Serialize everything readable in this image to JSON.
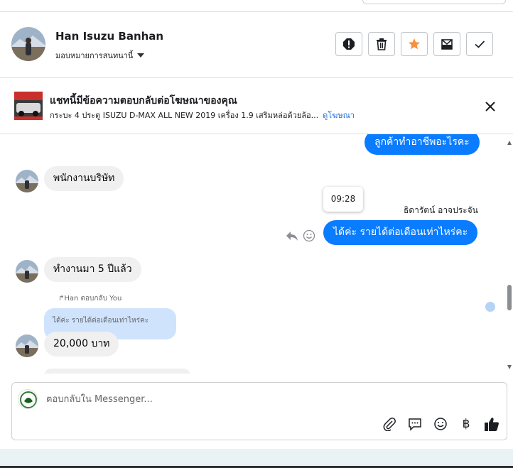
{
  "header": {
    "contact_name": "Han Isuzu Banhan",
    "assign_label": "มอบหมายการสนทนานี้",
    "action_icons": [
      "alert-icon",
      "trash-icon",
      "star-icon",
      "mark-unread-icon",
      "check-icon"
    ],
    "star_color": "#f5903d"
  },
  "ad": {
    "title": "แชทนี้มีข้อความตอบกลับต่อโฆษณาของคุณ",
    "description": "กระบะ 4 ประตู ISUZU D-MAX ALL NEW 2019 เครื่อง 1.9 เสริมหล่อด้วยล้อ...",
    "link": "ดูโฆษณา"
  },
  "messages": {
    "m1": "ลูกค้าทำอาชีพอะไรคะ",
    "m2": "พนักงานบริษัท",
    "tooltip_time": "09:28",
    "sender_name": "ธิดารัตน์ อาจประจัน",
    "m3": "ได้ค่ะ รายได้ต่อเดือนเท่าไหร่คะ",
    "m4": "ทำงานมา 5 ปีแล้ว",
    "reply_header": "Han ตอบกลับ You",
    "quoted_text": "ได้ค่ะ รายได้ต่อเดือนเท่าไหร่คะ",
    "m5": "20,000 บาท"
  },
  "composer": {
    "placeholder": "ตอบกลับใน Messenger...",
    "tool_icons": [
      "attach-icon",
      "saved-reply-icon",
      "emoji-icon",
      "baht-icon",
      "like-icon"
    ],
    "currency_glyph": "฿"
  },
  "colors": {
    "accent": "#0a7cff",
    "incoming_bubble": "#f0f0f0",
    "quoted_bubble": "#cfe3fc",
    "link": "#216fdb"
  }
}
